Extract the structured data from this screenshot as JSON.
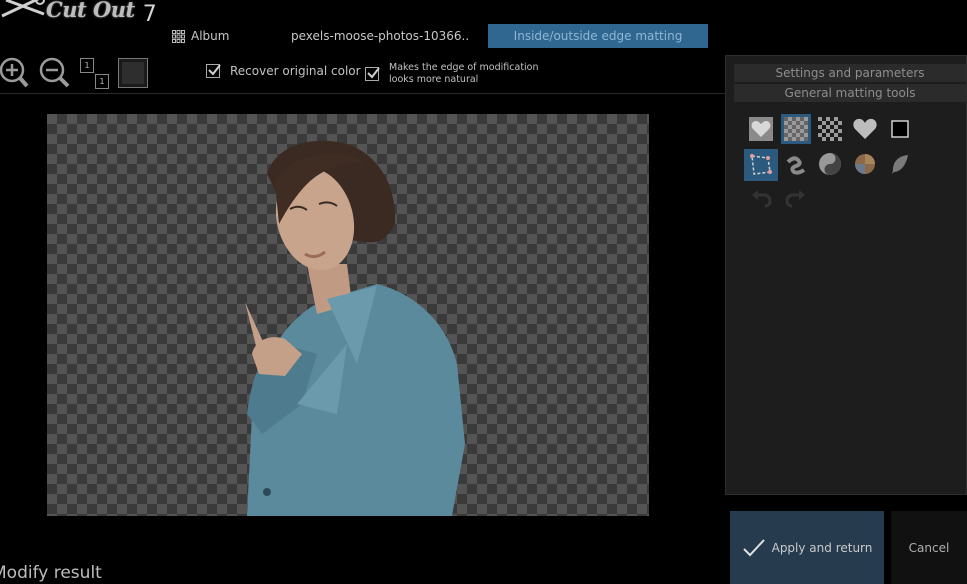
{
  "app": {
    "name": "Cut Out",
    "version": "7"
  },
  "tabs": {
    "album": "Album",
    "file": "pexels-moose-photos-10366..",
    "active": "Inside/outside edge matting"
  },
  "options": {
    "recover_color": "Recover original color",
    "natural_edge_line1": "Makes the edge of modification",
    "natural_edge_line2": "looks more natural"
  },
  "panel": {
    "settings": "Settings and parameters",
    "general": "General matting tools"
  },
  "actions": {
    "apply": "Apply and return",
    "cancel": "Cancel"
  },
  "footer": {
    "modify": "Modify result"
  },
  "zoom_fit": {
    "top": "1",
    "bottom": "1"
  },
  "colors": {
    "accent": "#2f6791",
    "apply_bg": "#263c4e",
    "background": "#000000"
  }
}
